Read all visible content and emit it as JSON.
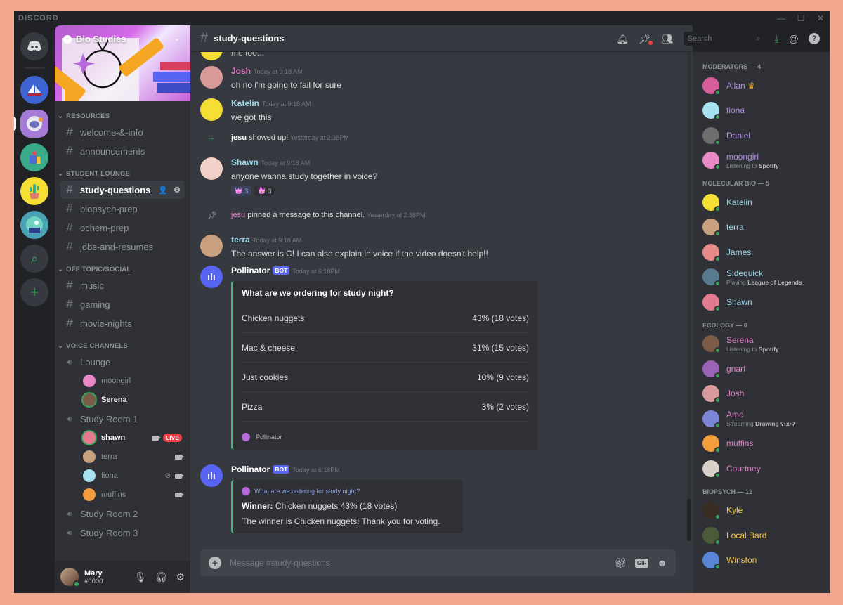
{
  "app": {
    "brand": "DISCORD",
    "window_controls": [
      "—",
      "☐",
      "✕"
    ]
  },
  "guilds": [
    {
      "name": "Home",
      "color": "#36393f"
    },
    {
      "name": "Sailboat server",
      "color": "#3e64d1"
    },
    {
      "name": "Astronaut server",
      "color": "#a67bd8",
      "selected": true
    },
    {
      "name": "Shopping server",
      "color": "#3aab8a"
    },
    {
      "name": "Cactus server",
      "color": "#f5df35"
    },
    {
      "name": "Monster server",
      "color": "#4aa3b5"
    }
  ],
  "guild_actions": {
    "explore": "⌕",
    "add": "+"
  },
  "server": {
    "name": "Bio Studies"
  },
  "categories": [
    {
      "name": "RESOURCES",
      "channels": [
        "welcome-&-info",
        "announcements"
      ]
    },
    {
      "name": "STUDENT LOUNGE",
      "channels": [
        "study-questions",
        "biopsych-prep",
        "ochem-prep",
        "jobs-and-resumes"
      ],
      "active": "study-questions"
    },
    {
      "name": "OFF TOPIC/SOCIAL",
      "channels": [
        "music",
        "gaming",
        "movie-nights"
      ]
    }
  ],
  "voice": {
    "category": "VOICE CHANNELS",
    "channels": [
      {
        "name": "Lounge",
        "users": [
          {
            "name": "moongirl",
            "color": "#e889c6"
          },
          {
            "name": "Serena",
            "color": "#7b5b48",
            "speaking": true
          }
        ]
      },
      {
        "name": "Study Room 1",
        "users": [
          {
            "name": "shawn",
            "color": "#e37a8f",
            "speaking": true,
            "live": "LIVE",
            "video": true
          },
          {
            "name": "terra",
            "color": "#c89f7f",
            "video": true
          },
          {
            "name": "fiona",
            "color": "#a7e0ef",
            "video": true,
            "muted": true
          },
          {
            "name": "muffins",
            "color": "#f29e3d",
            "video": true
          }
        ]
      },
      {
        "name": "Study Room 2",
        "users": []
      },
      {
        "name": "Study Room 3",
        "users": []
      }
    ]
  },
  "user": {
    "name": "Mary",
    "tag": "#0000"
  },
  "channel": {
    "name": "study-questions"
  },
  "search": {
    "placeholder": "Search"
  },
  "messages": {
    "cut": "me too...",
    "josh": {
      "name": "Josh",
      "color": "#e07fc7",
      "time": "Today at 9:18 AM",
      "text": "oh no i'm going to fail for sure"
    },
    "katelin": {
      "name": "Katelin",
      "color": "#9bd7e8",
      "time": "Today at 9:18 AM",
      "text": "we got this"
    },
    "join": {
      "user": "jesu",
      "text": "showed up!",
      "time": "Yesterday at 2:38PM"
    },
    "shawn": {
      "name": "Shawn",
      "color": "#9bd7e8",
      "time": "Today at 9:18 AM",
      "text": "anyone wanna study together in voice?",
      "reactions": [
        {
          "emoji": "👑",
          "count": "3",
          "on": true
        },
        {
          "emoji": "👑",
          "count": "3",
          "on": false
        }
      ]
    },
    "pin": {
      "user": "jesu",
      "text": "pinned a message to this channel.",
      "time": "Yesterday at 2:38PM"
    },
    "terra": {
      "name": "terra",
      "color": "#9bd7e8",
      "time": "Today at 9:18 AM",
      "text": "The answer is C! I can also explain in voice if the video doesn't help!!"
    },
    "poll": {
      "name": "Pollinator",
      "badge": "BOT",
      "time": "Today at 6:18PM",
      "question": "What are we ordering for study night?",
      "options": [
        {
          "label": "Chicken nuggets",
          "result": "43% (18 votes)"
        },
        {
          "label": "Mac & cheese",
          "result": "31% (15 votes)"
        },
        {
          "label": "Just cookies",
          "result": "10% (9 votes)"
        },
        {
          "label": "Pizza",
          "result": "3% (2 votes)"
        }
      ],
      "footer": "Pollinator"
    },
    "result": {
      "name": "Pollinator",
      "badge": "BOT",
      "time": "Today at 6:18PM",
      "link": "What are we ordering for study night?",
      "winner_label": "Winner:",
      "winner_text": "Chicken nuggets 43% (18 votes)",
      "thanks": "The winner is Chicken nuggets! Thank you for voting."
    }
  },
  "composer": {
    "placeholder": "Message #study-questions"
  },
  "members": [
    {
      "group": "MODERATORS — 4",
      "items": [
        {
          "name": "Allan",
          "color": "#b08de0",
          "crown": true,
          "av": "#d75e9b"
        },
        {
          "name": "fiona",
          "color": "#b08de0",
          "av": "#a7e0ef"
        },
        {
          "name": "Daniel",
          "color": "#b08de0",
          "av": "#6e6e6e"
        },
        {
          "name": "moongirl",
          "color": "#b08de0",
          "av": "#e889c6",
          "activity": "Listening to",
          "bold": "Spotify"
        }
      ]
    },
    {
      "group": "MOLECULAR BIO — 5",
      "items": [
        {
          "name": "Katelin",
          "color": "#9bd7e8",
          "av": "#f5df35"
        },
        {
          "name": "terra",
          "color": "#9bd7e8",
          "av": "#c89f7f"
        },
        {
          "name": "James",
          "color": "#9bd7e8",
          "av": "#e88a8a"
        },
        {
          "name": "Sidequick",
          "color": "#9bd7e8",
          "av": "#577a8f",
          "activity": "Playing",
          "bold": "League of Legends"
        },
        {
          "name": "Shawn",
          "color": "#9bd7e8",
          "av": "#e37a8f"
        }
      ]
    },
    {
      "group": "ECOLOGY — 6",
      "items": [
        {
          "name": "Serena",
          "color": "#e07fc7",
          "av": "#7b5b48",
          "activity": "Listening to",
          "bold": "Spotify"
        },
        {
          "name": "gnarf",
          "color": "#e07fc7",
          "av": "#9b63b5"
        },
        {
          "name": "Josh",
          "color": "#e07fc7",
          "av": "#d99a9a"
        },
        {
          "name": "Amo",
          "color": "#e07fc7",
          "av": "#7c84d6",
          "activity": "Streaming",
          "bold": "Drawing ʕ•ᴥ•ʔ"
        },
        {
          "name": "muffins",
          "color": "#e07fc7",
          "av": "#f29e3d"
        },
        {
          "name": "Courtney",
          "color": "#e07fc7",
          "av": "#d8d0c8"
        }
      ]
    },
    {
      "group": "BIOPSYCH — 12",
      "items": [
        {
          "name": "Kyle",
          "color": "#f5c542",
          "av": "#3a2d22"
        },
        {
          "name": "Local Bard",
          "color": "#f5c542",
          "av": "#4d5a3a"
        },
        {
          "name": "Winston",
          "color": "#f5c542",
          "av": "#5a86d6"
        }
      ]
    }
  ]
}
